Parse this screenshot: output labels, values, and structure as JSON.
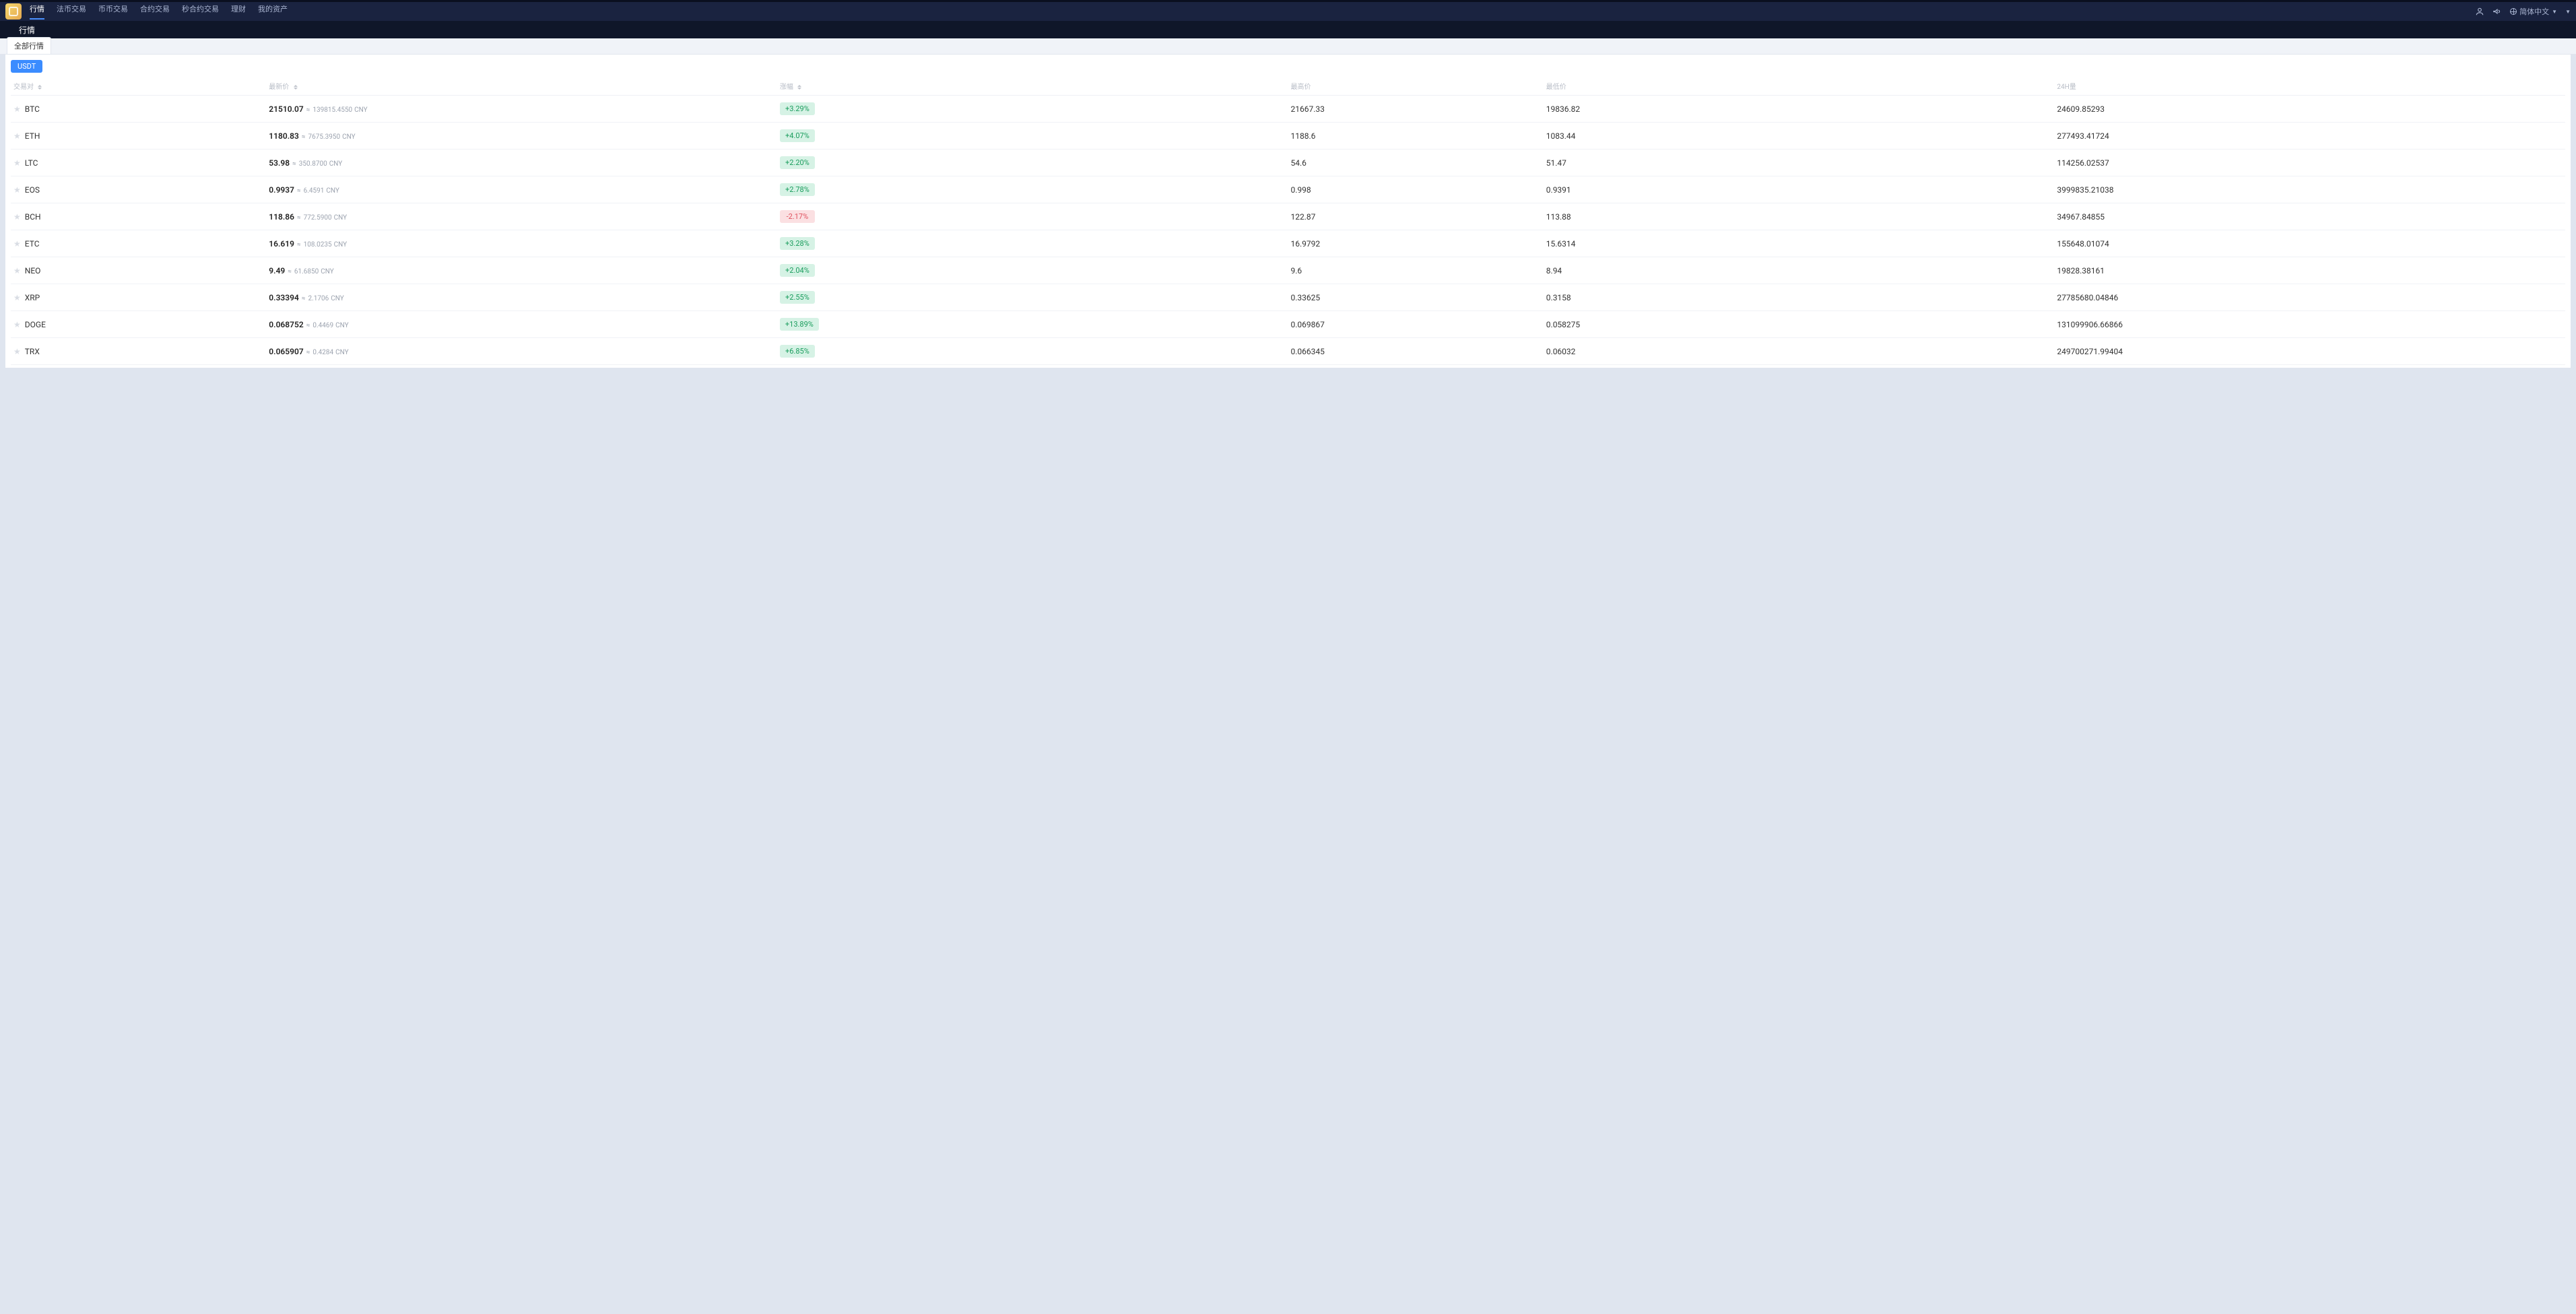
{
  "nav": {
    "items": [
      "行情",
      "法币交易",
      "币币交易",
      "合约交易",
      "秒合约交易",
      "理财",
      "我的资产"
    ],
    "activeIndex": 0,
    "language": "简体中文"
  },
  "subnav": {
    "title": "行情"
  },
  "tabbar": {
    "tab": "全部行情"
  },
  "filter": {
    "label": "USDT"
  },
  "columns": {
    "pair": "交易对",
    "price": "最新价",
    "change": "涨幅",
    "high": "最高价",
    "low": "最低价",
    "volume": "24H量"
  },
  "cnyUnit": "CNY",
  "eqSym": "≈",
  "rows": [
    {
      "sym": "BTC",
      "price": "21510.07",
      "cny": "139815.4550",
      "chg": "+3.29%",
      "dir": "up",
      "high": "21667.33",
      "low": "19836.82",
      "vol": "24609.85293"
    },
    {
      "sym": "ETH",
      "price": "1180.83",
      "cny": "7675.3950",
      "chg": "+4.07%",
      "dir": "up",
      "high": "1188.6",
      "low": "1083.44",
      "vol": "277493.41724"
    },
    {
      "sym": "LTC",
      "price": "53.98",
      "cny": "350.8700",
      "chg": "+2.20%",
      "dir": "up",
      "high": "54.6",
      "low": "51.47",
      "vol": "114256.02537"
    },
    {
      "sym": "EOS",
      "price": "0.9937",
      "cny": "6.4591",
      "chg": "+2.78%",
      "dir": "up",
      "high": "0.998",
      "low": "0.9391",
      "vol": "3999835.21038"
    },
    {
      "sym": "BCH",
      "price": "118.86",
      "cny": "772.5900",
      "chg": "-2.17%",
      "dir": "dn",
      "high": "122.87",
      "low": "113.88",
      "vol": "34967.84855"
    },
    {
      "sym": "ETC",
      "price": "16.619",
      "cny": "108.0235",
      "chg": "+3.28%",
      "dir": "up",
      "high": "16.9792",
      "low": "15.6314",
      "vol": "155648.01074"
    },
    {
      "sym": "NEO",
      "price": "9.49",
      "cny": "61.6850",
      "chg": "+2.04%",
      "dir": "up",
      "high": "9.6",
      "low": "8.94",
      "vol": "19828.38161"
    },
    {
      "sym": "XRP",
      "price": "0.33394",
      "cny": "2.1706",
      "chg": "+2.55%",
      "dir": "up",
      "high": "0.33625",
      "low": "0.3158",
      "vol": "27785680.04846"
    },
    {
      "sym": "DOGE",
      "price": "0.068752",
      "cny": "0.4469",
      "chg": "+13.89%",
      "dir": "up",
      "high": "0.069867",
      "low": "0.058275",
      "vol": "131099906.66866"
    },
    {
      "sym": "TRX",
      "price": "0.065907",
      "cny": "0.4284",
      "chg": "+6.85%",
      "dir": "up",
      "high": "0.066345",
      "low": "0.06032",
      "vol": "249700271.99404"
    }
  ]
}
